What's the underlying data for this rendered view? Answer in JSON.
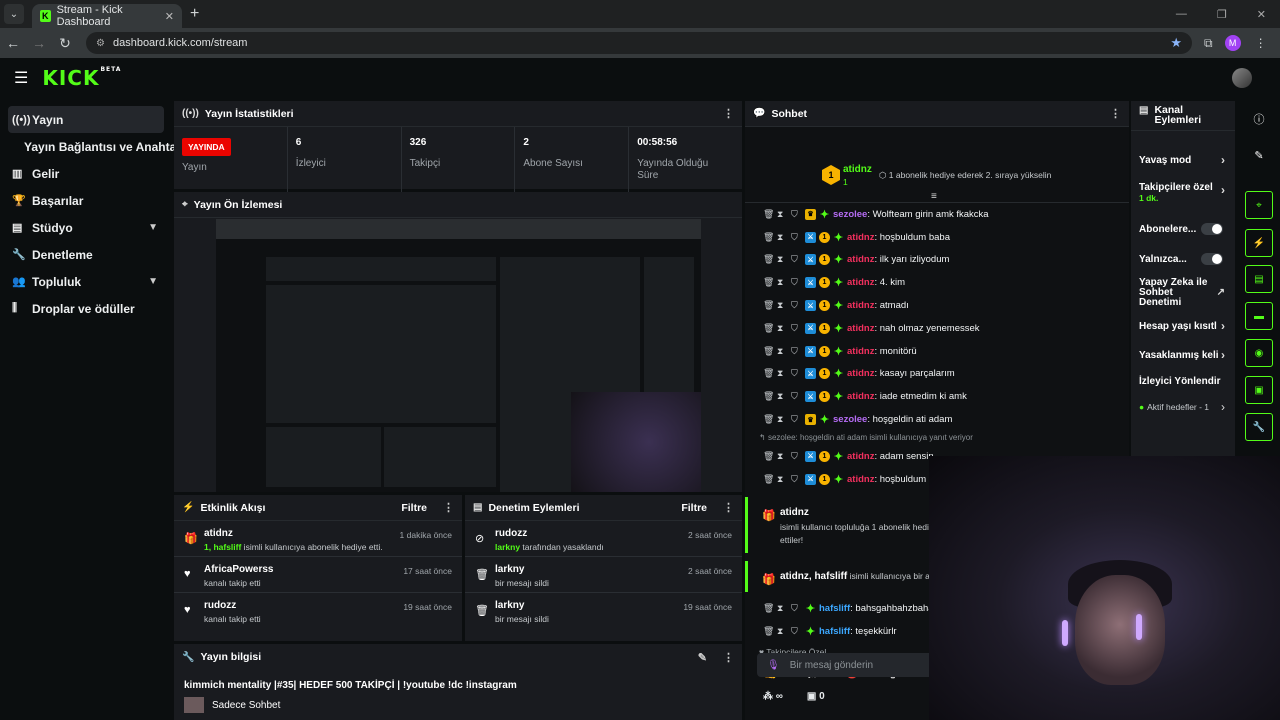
{
  "browser": {
    "tab_title": "Stream - Kick Dashboard",
    "url": "dashboard.kick.com/stream",
    "profile_initial": "M"
  },
  "app": {
    "logo": "KICK",
    "logo_badge": "BETA"
  },
  "sidebar": {
    "items": [
      {
        "label": "Yayın",
        "icon": "broadcast-icon"
      },
      {
        "label": "Yayın Bağlantısı ve Anahtarı"
      },
      {
        "label": "Gelir",
        "icon": "chart-icon"
      },
      {
        "label": "Başarılar",
        "icon": "trophy-icon"
      },
      {
        "label": "Stüdyo",
        "icon": "studio-icon"
      },
      {
        "label": "Denetleme",
        "icon": "wrench-icon"
      },
      {
        "label": "Topluluk",
        "icon": "community-icon"
      },
      {
        "label": "Droplar ve ödüller",
        "icon": "drops-icon"
      }
    ]
  },
  "stats_panel": {
    "title": "Yayın İstatistikleri",
    "live_badge": "YAYINDA",
    "live_label": "Yayın",
    "viewers_value": "6",
    "viewers_label": "İzleyici",
    "followers_value": "326",
    "followers_label": "Takipçi",
    "subs_value": "2",
    "subs_label": "Abone Sayısı",
    "uptime_value": "00:58:56",
    "uptime_label": "Yayında Olduğu Süre"
  },
  "preview_panel": {
    "title": "Yayın Ön İzlemesi"
  },
  "activity_panel": {
    "title": "Etkinlik Akışı",
    "filter": "Filtre",
    "rows": [
      {
        "name": "atidnz",
        "desc_highlight": "1, hafsliff",
        "desc": " isimli kullanıcıya abonelik hediye etti.",
        "time": "1 dakika önce"
      },
      {
        "name": "AfricaPowerss",
        "desc_highlight": "",
        "desc": "kanalı takip etti",
        "time": "17 saat önce"
      },
      {
        "name": "rudozz",
        "desc_highlight": "",
        "desc": "kanalı takip etti",
        "time": "19 saat önce"
      }
    ]
  },
  "mod_panel": {
    "title": "Denetim Eylemleri",
    "filter": "Filtre",
    "rows": [
      {
        "name": "rudozz",
        "desc_highlight": "larkny",
        "desc": " tarafından yasaklandı",
        "time": "2 saat önce"
      },
      {
        "name": "larkny",
        "desc_highlight": "",
        "desc": "bir mesajı sildi",
        "time": "2 saat önce"
      },
      {
        "name": "larkny",
        "desc_highlight": "",
        "desc": "bir mesajı sildi",
        "time": "19 saat önce"
      }
    ]
  },
  "info_panel": {
    "title": "Yayın bilgisi",
    "stream_title": "kimmich mentality |#35| HEDEF 500 TAKİPÇİ | !youtube !dc !instagram",
    "category": "Sadece Sohbet"
  },
  "chat": {
    "title": "Sohbet",
    "pinned_name": "atidnz",
    "pinned_count": "1",
    "pinned_text": "1 abonelik hediye ederek 2. sıraya yükselin",
    "messages": [
      {
        "user": "sezolee",
        "text": ": Wolfteam girin amk fkakcka",
        "style": "u1"
      },
      {
        "user": "atidnz",
        "text": ": hoşbuldum baba",
        "style": "u2"
      },
      {
        "user": "atidnz",
        "text": ": ilk yarı izliyodum",
        "style": "u2"
      },
      {
        "user": "atidnz",
        "text": ": 4. kim",
        "style": "u2"
      },
      {
        "user": "atidnz",
        "text": ": atmadı",
        "style": "u2"
      },
      {
        "user": "atidnz",
        "text": ": nah olmaz yenemessek",
        "style": "u2"
      },
      {
        "user": "atidnz",
        "text": ": monitörü",
        "style": "u2"
      },
      {
        "user": "atidnz",
        "text": ": kasayı parçalarım",
        "style": "u2"
      },
      {
        "user": "atidnz",
        "text": ": iade etmedim ki amk",
        "style": "u2"
      },
      {
        "user": "sezolee",
        "text": ": hoşgeldin ati adam",
        "style": "u1"
      }
    ],
    "reply_note": "sezolee: hoşgeldin ati adam isimli kullanıcıya yanıt veriyor",
    "messages2": [
      {
        "user": "atidnz",
        "text": ": adam sensin",
        "style": "u2"
      },
      {
        "user": "atidnz",
        "text": ": hoşbuldum",
        "style": "u2"
      }
    ],
    "gift1_name": "atidnz",
    "gift1_text": "isimli kullanıcı topluluğa 1 abonelik hedi",
    "gift1_text2": "ettiler!",
    "gift2_names": "atidnz, hafsliff",
    "gift2_text": " isimli kullanıcıya bir abo",
    "messages3": [
      {
        "user": "hafsliff",
        "text": ": bahsgahbahzbaha",
        "style": "u3"
      },
      {
        "user": "hafsliff",
        "text": ": teşekkürlr",
        "style": "u3"
      }
    ],
    "followers_only": "Takipçilere Özel",
    "input_placeholder": "Bir mesaj gönderin",
    "points": "0",
    "infinity": "∞"
  },
  "channel_actions": {
    "title": "Kanal Eylemleri",
    "items": [
      {
        "label": "Yavaş mod",
        "sub": ""
      },
      {
        "label": "Takipçilere özel",
        "sub": "1 dk."
      },
      {
        "label": "Abonelere...",
        "sub": ""
      },
      {
        "label": "Yalnızca...",
        "sub": ""
      },
      {
        "label": "Yapay Zeka ile Sohbet Denetimi",
        "sub": ""
      },
      {
        "label": "Hesap yaşı kısıtl",
        "sub": ""
      },
      {
        "label": "Yasaklanmış keli",
        "sub": ""
      },
      {
        "label": "İzleyici Yönlendir",
        "sub": ""
      },
      {
        "label": "Aktif hedefler - 1",
        "sub": ""
      }
    ]
  }
}
